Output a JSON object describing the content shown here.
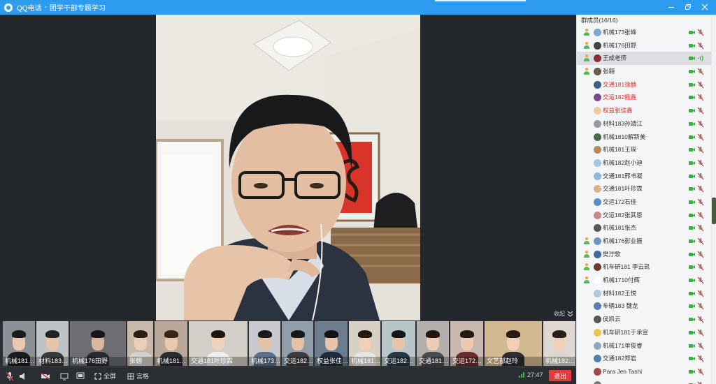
{
  "window": {
    "app_name": "QQ电话",
    "separator": "-",
    "group_name": "团学干部专题学习"
  },
  "stage": {
    "collapse_label": "收起"
  },
  "thumbnails": [
    {
      "label": "机械181…",
      "bg": "#8d8f96",
      "skin": "#e8c9b0",
      "hair": "#1b1b1b",
      "shirt": "#1c1c1c"
    },
    {
      "label": "材料183…",
      "bg": "#bfc2c6",
      "skin": "#e6c6aa",
      "hair": "#222",
      "shirt": "#3a3a3a"
    },
    {
      "label": "机械176田野",
      "bg": "#6d6e73",
      "skin": "#d8b89e",
      "hair": "#161616",
      "shirt": "#2a2a2e"
    },
    {
      "label": "张翱",
      "bg": "#c9b9ad",
      "skin": "#eccdb6",
      "hair": "#2b1d14",
      "shirt": "#d4d0cc"
    },
    {
      "label": "机械181…",
      "bg": "#b9a89a",
      "skin": "#e9c8ad",
      "hair": "#3a2416",
      "shirt": "#2b2b30"
    },
    {
      "label": "交通181叶珍霖",
      "bg": "#d2cec8",
      "skin": "#f0d2bc",
      "hair": "#1c1410",
      "shirt": "#eeeeee"
    },
    {
      "label": "机械173…",
      "bg": "#c7c9cc",
      "skin": "#e3c2a5",
      "hair": "#1a1a1a",
      "shirt": "#5d6f8a"
    },
    {
      "label": "交运182…",
      "bg": "#8f9ea9",
      "skin": "#e2c1a6",
      "hair": "#181818",
      "shirt": "#3c3c3c"
    },
    {
      "label": "权益张佳…",
      "bg": "#6c7d8f",
      "skin": "#e6c4a8",
      "hair": "#121212",
      "shirt": "#1f2a3a"
    },
    {
      "label": "机械181…",
      "bg": "#d8cfc5",
      "skin": "#f0d0b8",
      "hair": "#231812",
      "shirt": "#e8e4df"
    },
    {
      "label": "交运182…",
      "bg": "#b8c5c9",
      "skin": "#e5c5a9",
      "hair": "#171717",
      "shirt": "#263846"
    },
    {
      "label": "交通181…",
      "bg": "#b3b0ab",
      "skin": "#ecccb2",
      "hair": "#201711",
      "shirt": "#4b4b4f"
    },
    {
      "label": "交运172…",
      "bg": "#c8b8b0",
      "skin": "#eccab1",
      "hair": "#241a14",
      "shirt": "#6b2c2c"
    },
    {
      "label": "文艺部赵玲",
      "bg": "#d3b991",
      "skin": "#f0d0b6",
      "hair": "#2a1c14",
      "shirt": "#2d2d32"
    },
    {
      "label": "机械182…",
      "bg": "#ddd8d2",
      "skin": "#f0d2bc",
      "hair": "#2b1e16",
      "shirt": "#d9d4ce"
    }
  ],
  "controls": {
    "fullscreen_label": "全屏",
    "grid_label": "宫格",
    "elapsed": "27:47",
    "exit_label": "退出"
  },
  "panel": {
    "title": "群成员(16/16)",
    "members": [
      {
        "name": "机械173张峰",
        "role": true,
        "red": false,
        "avatar": "#7fa7c9",
        "active": false,
        "speaking": false
      },
      {
        "name": "机械176田野",
        "role": true,
        "red": false,
        "avatar": "#444",
        "active": false,
        "speaking": false
      },
      {
        "name": "王成老师",
        "role": true,
        "red": false,
        "avatar": "#8a2f2f",
        "active": true,
        "speaking": true
      },
      {
        "name": "张翱",
        "role": true,
        "red": false,
        "avatar": "#6b5a4b",
        "active": false,
        "speaking": false
      },
      {
        "name": "交通181徐赫",
        "role": false,
        "red": true,
        "avatar": "#3b5f8a",
        "active": false,
        "speaking": false
      },
      {
        "name": "交运182熊鑫",
        "role": false,
        "red": true,
        "avatar": "#7a4a8f",
        "active": false,
        "speaking": false
      },
      {
        "name": "权益张佳鑫",
        "role": false,
        "red": true,
        "avatar": "#f0c9a0",
        "active": false,
        "speaking": false
      },
      {
        "name": "材料183孙靖江",
        "role": false,
        "red": false,
        "avatar": "#9a9a9a",
        "active": false,
        "speaking": false
      },
      {
        "name": "机械1810解新美",
        "role": false,
        "red": false,
        "avatar": "#4a6b4a",
        "active": false,
        "speaking": false
      },
      {
        "name": "机械181王琛",
        "role": false,
        "red": false,
        "avatar": "#b88a5a",
        "active": false,
        "speaking": false
      },
      {
        "name": "机械182赵小迪",
        "role": false,
        "red": false,
        "avatar": "#a3c4e8",
        "active": false,
        "speaking": false
      },
      {
        "name": "交通181邢书凝",
        "role": false,
        "red": false,
        "avatar": "#8fb7d9",
        "active": false,
        "speaking": false
      },
      {
        "name": "交通181叶珍霖",
        "role": false,
        "red": false,
        "avatar": "#d9b38c",
        "active": false,
        "speaking": false
      },
      {
        "name": "交运172石佳",
        "role": false,
        "red": false,
        "avatar": "#5a8fc9",
        "active": false,
        "speaking": false
      },
      {
        "name": "交运182张其恩",
        "role": false,
        "red": false,
        "avatar": "#c98a8a",
        "active": false,
        "speaking": false
      },
      {
        "name": "机械181张杰",
        "role": false,
        "red": false,
        "avatar": "#555",
        "active": false,
        "speaking": false
      },
      {
        "name": "机械176彭业振",
        "role": true,
        "red": false,
        "avatar": "#6f96c2",
        "active": false,
        "speaking": false
      },
      {
        "name": "樊泞歌",
        "role": true,
        "red": false,
        "avatar": "#3e6aa3",
        "active": false,
        "speaking": false
      },
      {
        "name": "机车研181 李云凯",
        "role": true,
        "red": false,
        "avatar": "#6b3b2b",
        "active": false,
        "speaking": false
      },
      {
        "name": "机械1710付辉",
        "role": true,
        "red": false,
        "avatar": "#ffffff",
        "active": false,
        "speaking": false
      },
      {
        "name": "材料182王悦",
        "role": false,
        "red": false,
        "avatar": "#b0c8e0",
        "active": false,
        "speaking": false
      },
      {
        "name": "车辆183 魏龙",
        "role": false,
        "red": false,
        "avatar": "#5b7fa8",
        "active": false,
        "speaking": false
      },
      {
        "name": "侯凯云",
        "role": false,
        "red": false,
        "avatar": "#555",
        "active": false,
        "speaking": false
      },
      {
        "name": "机车研181于承宣",
        "role": false,
        "red": false,
        "avatar": "#e8c84a",
        "active": false,
        "speaking": false
      },
      {
        "name": "机械171单俊睿",
        "role": false,
        "red": false,
        "avatar": "#8fa8bf",
        "active": false,
        "speaking": false
      },
      {
        "name": "交通182郑岩",
        "role": false,
        "red": false,
        "avatar": "#4f7fb0",
        "active": false,
        "speaking": false
      },
      {
        "name": "Para Jen Tashi",
        "role": false,
        "red": false,
        "avatar": "#a34848",
        "active": false,
        "speaking": false
      },
      {
        "name": "",
        "role": false,
        "red": false,
        "avatar": "#777",
        "active": false,
        "speaking": false
      }
    ]
  },
  "colors": {
    "titlebar": "#2d9cf0",
    "exit": "#e23b3b",
    "camera_on": "#38b03f",
    "mic_muted": "#e03030",
    "admin_red": "#e02c2c"
  }
}
